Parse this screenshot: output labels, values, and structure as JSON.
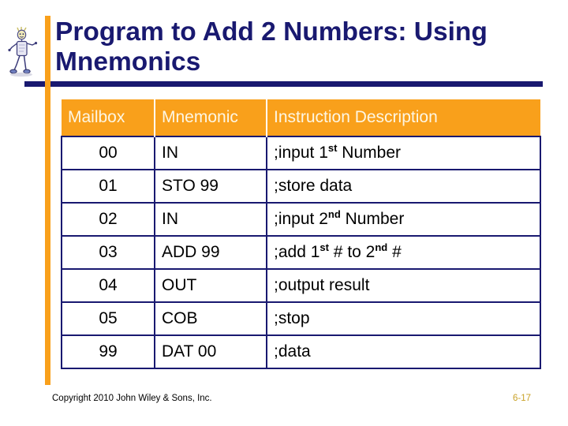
{
  "slide": {
    "title_line1": "Program to Add 2 Numbers:",
    "title_line2": "Using Mnemonics",
    "title_full": "Program to Add 2 Numbers: Using Mnemonics",
    "mascot_icon": "stick-figure-icon",
    "accent_color": "#f9a01b",
    "title_color": "#191970",
    "rule_color": "#191970",
    "header_text_color": "#fdf6e3",
    "table_border_color": "#191970"
  },
  "table": {
    "columns": [
      "Mailbox",
      "Mnemonic",
      "Instruction Description"
    ],
    "rows": [
      {
        "mailbox": "00",
        "mnemonic": "IN",
        "desc_pre": ";input 1",
        "desc_sup": "st",
        "desc_post": " Number",
        "desc_sup2": "",
        "desc_post2": "",
        "desc_plain": ";input 1st Number"
      },
      {
        "mailbox": "01",
        "mnemonic": "STO 99",
        "desc_pre": ";store data",
        "desc_sup": "",
        "desc_post": "",
        "desc_sup2": "",
        "desc_post2": "",
        "desc_plain": ";store data"
      },
      {
        "mailbox": "02",
        "mnemonic": "IN",
        "desc_pre": ";input 2",
        "desc_sup": "nd",
        "desc_post": " Number",
        "desc_sup2": "",
        "desc_post2": "",
        "desc_plain": ";input 2nd Number"
      },
      {
        "mailbox": "03",
        "mnemonic": "ADD 99",
        "desc_pre": ";add 1",
        "desc_sup": "st",
        "desc_post": " # to 2",
        "desc_sup2": "nd",
        "desc_post2": " #",
        "desc_plain": ";add 1st # to 2nd #"
      },
      {
        "mailbox": "04",
        "mnemonic": "OUT",
        "desc_pre": ";output result",
        "desc_sup": "",
        "desc_post": "",
        "desc_sup2": "",
        "desc_post2": "",
        "desc_plain": ";output result"
      },
      {
        "mailbox": "05",
        "mnemonic": "COB",
        "desc_pre": ";stop",
        "desc_sup": "",
        "desc_post": "",
        "desc_sup2": "",
        "desc_post2": "",
        "desc_plain": ";stop"
      },
      {
        "mailbox": "99",
        "mnemonic": "DAT 00",
        "desc_pre": ";data",
        "desc_sup": "",
        "desc_post": "",
        "desc_sup2": "",
        "desc_post2": "",
        "desc_plain": ";data"
      }
    ]
  },
  "footer": {
    "copyright": "Copyright 2010 John Wiley & Sons, Inc.",
    "page_number": "6-17",
    "page_number_color": "#c9a227"
  }
}
